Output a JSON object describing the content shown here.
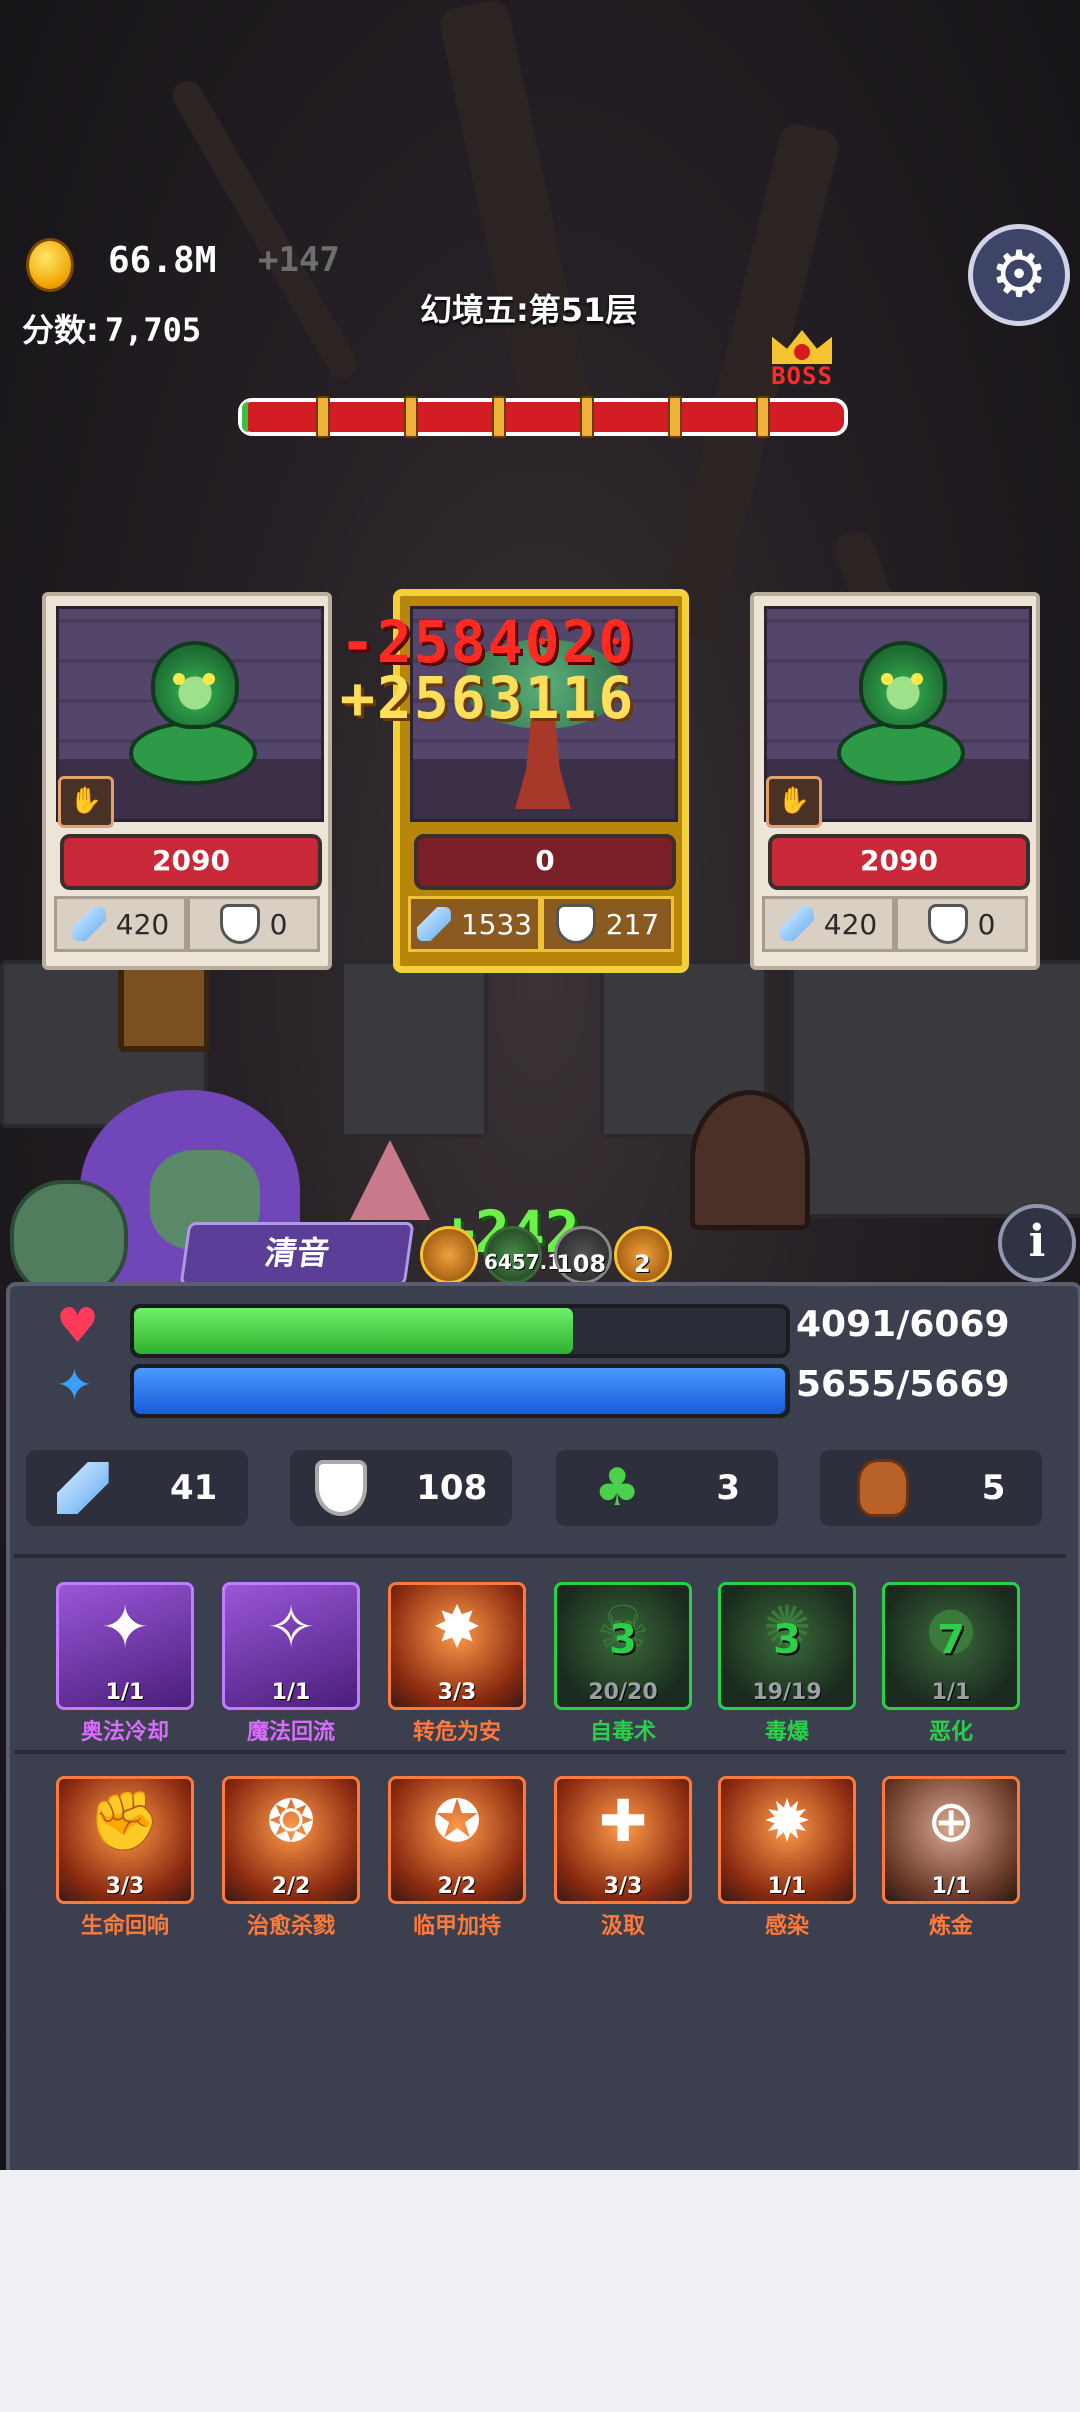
{
  "hud": {
    "gold": "66.8M",
    "gold_gain": "+147",
    "score_label": "分数:",
    "score": "7,705",
    "level_title": "幻境五:第51层",
    "boss_label": "BOSS",
    "stage_progress": 0.01,
    "settings_icon": "gear-icon"
  },
  "enemies": [
    {
      "name": "snake",
      "hp": "2090",
      "atk": "420",
      "def": "0",
      "skill_icon": "claw-icon"
    },
    {
      "name": "tree",
      "hp": "0",
      "atk": "1533",
      "def": "217",
      "active": true
    },
    {
      "name": "snake",
      "hp": "2090",
      "atk": "420",
      "def": "0",
      "skill_icon": "claw-icon"
    }
  ],
  "floating": {
    "damage": "-2584020",
    "gold_popup": "+2563116",
    "heal": "+242"
  },
  "hero": {
    "name": "清音",
    "buffs": [
      {
        "label": ""
      },
      {
        "label": "6457.1"
      },
      {
        "label": "108"
      },
      {
        "label": "2"
      }
    ],
    "hp_text": "4091/6069",
    "hp_ratio": 0.674,
    "mp_text": "5655/5669",
    "mp_ratio": 0.998
  },
  "stats": {
    "attack": "41",
    "defense": "108",
    "luck": "3",
    "bag": "5"
  },
  "skills_row1": [
    {
      "name": "奥法冷却",
      "level": "1/1",
      "style": "purple",
      "glyph": "✦"
    },
    {
      "name": "魔法回流",
      "level": "1/1",
      "style": "purple",
      "glyph": "✧"
    },
    {
      "name": "转危为安",
      "level": "3/3",
      "style": "orange",
      "glyph": "✸"
    },
    {
      "name": "自毒术",
      "level": "20/20",
      "style": "green",
      "count": "3",
      "glyph": "☠"
    },
    {
      "name": "毒爆",
      "level": "19/19",
      "style": "green",
      "count": "3",
      "glyph": "✺"
    },
    {
      "name": "恶化",
      "level": "1/1",
      "style": "green",
      "count": "7",
      "glyph": "●"
    }
  ],
  "skills_row2": [
    {
      "name": "生命回响",
      "level": "3/3",
      "style": "orange",
      "glyph": "✊"
    },
    {
      "name": "治愈杀戮",
      "level": "2/2",
      "style": "orange",
      "glyph": "❂"
    },
    {
      "name": "临甲加持",
      "level": "2/2",
      "style": "orange",
      "glyph": "✪"
    },
    {
      "name": "汲取",
      "level": "3/3",
      "style": "orange",
      "glyph": "✚"
    },
    {
      "name": "感染",
      "level": "1/1",
      "style": "orange",
      "glyph": "✹"
    },
    {
      "name": "炼金",
      "level": "1/1",
      "style": "orange",
      "glyph": "⊕"
    }
  ],
  "colors": {
    "hp_bar": "#3ad43a",
    "mp_bar": "#2a7af0",
    "boss_bar": "#d31c24"
  }
}
